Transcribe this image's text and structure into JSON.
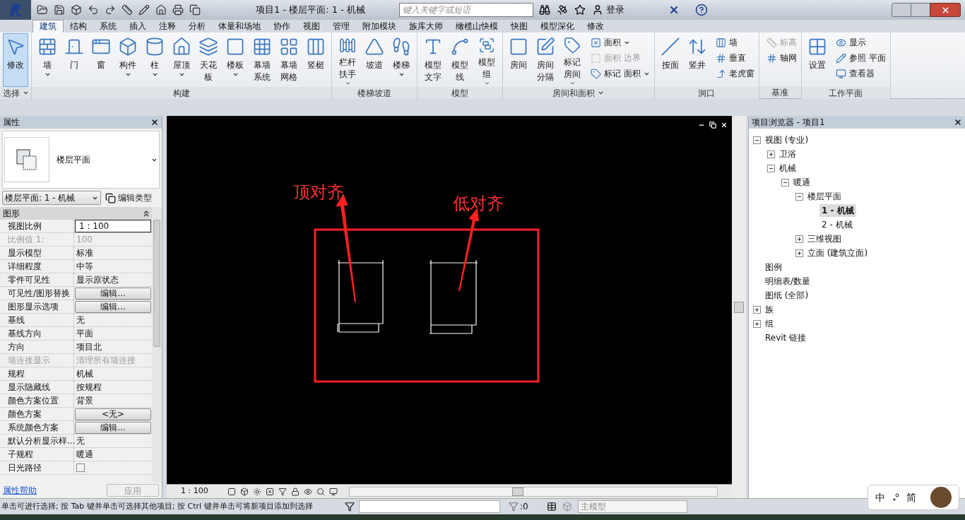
{
  "title_bar": {
    "title": "项目1 - 楼层平面: 1 - 机械",
    "search": {
      "placeholder": "键入关键字或短语"
    },
    "sign_in": "登录"
  },
  "tabs": [
    {
      "label": "建筑",
      "selected": true
    },
    {
      "label": "结构",
      "selected": false
    },
    {
      "label": "系统",
      "selected": false
    },
    {
      "label": "插入",
      "selected": false
    },
    {
      "label": "注释",
      "selected": false
    },
    {
      "label": "分析",
      "selected": false
    },
    {
      "label": "体量和场地",
      "selected": false
    },
    {
      "label": "协作",
      "selected": false
    },
    {
      "label": "视图",
      "selected": false
    },
    {
      "label": "管理",
      "selected": false
    },
    {
      "label": "附加模块",
      "selected": false
    },
    {
      "label": "族库大师",
      "selected": false
    },
    {
      "label": "橄榄山快模",
      "selected": false
    },
    {
      "label": "快图",
      "selected": false
    },
    {
      "label": "模型深化",
      "selected": false
    },
    {
      "label": "修改",
      "selected": false
    }
  ],
  "ribbon": [
    {
      "title": "选择",
      "menu": true,
      "tools": [
        {
          "label": "修改",
          "kind": "large",
          "dropdown": false,
          "disabled": false,
          "active": true
        }
      ]
    },
    {
      "title": "构建",
      "menu": false,
      "tools": [
        {
          "label": "墙",
          "kind": "large",
          "dropdown": true,
          "disabled": false,
          "active": false
        },
        {
          "label": "门",
          "kind": "large",
          "dropdown": false,
          "disabled": false,
          "active": false
        },
        {
          "label": "窗",
          "kind": "large",
          "dropdown": false,
          "disabled": false,
          "active": false
        },
        {
          "label": "构件",
          "kind": "large",
          "dropdown": true,
          "disabled": false,
          "active": false
        },
        {
          "label": "柱",
          "kind": "large",
          "dropdown": true,
          "disabled": false,
          "active": false
        },
        {
          "label": "屋顶",
          "kind": "large",
          "dropdown": true,
          "disabled": false,
          "active": false
        },
        {
          "label": "天花板",
          "kind": "large",
          "dropdown": false,
          "disabled": false,
          "active": false
        },
        {
          "label": "楼板",
          "kind": "large",
          "dropdown": true,
          "disabled": false,
          "active": false
        },
        {
          "label": "幕墙系统",
          "kind": "large",
          "dropdown": false,
          "disabled": false,
          "active": false
        },
        {
          "label": "幕墙网格",
          "kind": "large",
          "dropdown": false,
          "disabled": false,
          "active": false
        },
        {
          "label": "竖梃",
          "kind": "large",
          "dropdown": false,
          "disabled": false,
          "active": false
        }
      ]
    },
    {
      "title": "楼梯坡道",
      "menu": false,
      "tools": [
        {
          "label": "栏杆扶手",
          "kind": "large",
          "dropdown": true,
          "disabled": false,
          "active": false
        },
        {
          "label": "坡道",
          "kind": "large",
          "dropdown": false,
          "disabled": false,
          "active": false
        },
        {
          "label": "楼梯",
          "kind": "large",
          "dropdown": true,
          "disabled": false,
          "active": false
        }
      ]
    },
    {
      "title": "模型",
      "menu": false,
      "tools": [
        {
          "label": "模型文字",
          "kind": "large",
          "dropdown": false,
          "disabled": false,
          "active": false
        },
        {
          "label": "模型线",
          "kind": "large",
          "dropdown": false,
          "disabled": false,
          "active": false
        },
        {
          "label": "模型组",
          "kind": "large",
          "dropdown": true,
          "disabled": false,
          "active": false
        }
      ]
    },
    {
      "title": "房间和面积",
      "menu": true,
      "tools": [
        {
          "label": "房间",
          "kind": "large",
          "dropdown": false,
          "disabled": false,
          "active": false
        },
        {
          "label": "房间分隔",
          "kind": "large",
          "dropdown": false,
          "disabled": false,
          "active": false
        },
        {
          "label": "标记房间",
          "kind": "large",
          "dropdown": true,
          "disabled": false,
          "active": false
        },
        {
          "label": "面积",
          "kind": "small",
          "dropdown": true,
          "disabled": false,
          "active": false
        },
        {
          "label": "面积 边界",
          "kind": "small",
          "dropdown": false,
          "disabled": true,
          "active": false
        },
        {
          "label": "标记 面积",
          "kind": "small",
          "dropdown": true,
          "disabled": false,
          "active": false
        }
      ]
    },
    {
      "title": "洞口",
      "menu": false,
      "tools": [
        {
          "label": "按面",
          "kind": "large",
          "dropdown": false,
          "disabled": false,
          "active": false
        },
        {
          "label": "竖井",
          "kind": "large",
          "dropdown": false,
          "disabled": false,
          "active": false
        },
        {
          "label": "墙",
          "kind": "small",
          "dropdown": false,
          "disabled": false,
          "active": false
        },
        {
          "label": "垂直",
          "kind": "small",
          "dropdown": false,
          "disabled": false,
          "active": false
        },
        {
          "label": "老虎窗",
          "kind": "small",
          "dropdown": false,
          "disabled": false,
          "active": false
        }
      ]
    },
    {
      "title": "基准",
      "menu": false,
      "tools": [
        {
          "label": "标高",
          "kind": "small",
          "dropdown": false,
          "disabled": true,
          "active": false
        },
        {
          "label": "轴网",
          "kind": "small",
          "dropdown": false,
          "disabled": false,
          "active": false
        }
      ]
    },
    {
      "title": "工作平面",
      "menu": false,
      "tools": [
        {
          "label": "设置",
          "kind": "large",
          "dropdown": false,
          "disabled": false,
          "active": false
        },
        {
          "label": "显示",
          "kind": "small",
          "dropdown": false,
          "disabled": false,
          "active": false
        },
        {
          "label": "参照 平面",
          "kind": "small",
          "dropdown": false,
          "disabled": false,
          "active": false
        },
        {
          "label": "查看器",
          "kind": "small",
          "dropdown": false,
          "disabled": false,
          "active": false
        }
      ]
    }
  ],
  "properties": {
    "title": "属性",
    "type_name": "楼层平面",
    "instance": "楼层平面: 1 - 机械",
    "edit_type": "编辑类型",
    "section": "图形",
    "rows": [
      {
        "label": "视图比例",
        "value": "1 : 100",
        "kind": "input",
        "disabled": false
      },
      {
        "label": "比例值 1:",
        "value": "100",
        "kind": "text",
        "disabled": true
      },
      {
        "label": "显示模型",
        "value": "标准",
        "kind": "text",
        "disabled": false
      },
      {
        "label": "详细程度",
        "value": "中等",
        "kind": "text",
        "disabled": false
      },
      {
        "label": "零件可见性",
        "value": "显示原状态",
        "kind": "text",
        "disabled": false
      },
      {
        "label": "可见性/图形替换",
        "value": "编辑...",
        "kind": "button",
        "disabled": false
      },
      {
        "label": "图形显示选项",
        "value": "编辑...",
        "kind": "button",
        "disabled": false
      },
      {
        "label": "基线",
        "value": "无",
        "kind": "text",
        "disabled": false
      },
      {
        "label": "基线方向",
        "value": "平面",
        "kind": "text",
        "disabled": false
      },
      {
        "label": "方向",
        "value": "项目北",
        "kind": "text",
        "disabled": false
      },
      {
        "label": "墙连接显示",
        "value": "清理所有墙连接",
        "kind": "text",
        "disabled": true
      },
      {
        "label": "规程",
        "value": "机械",
        "kind": "text",
        "disabled": false
      },
      {
        "label": "显示隐藏线",
        "value": "按规程",
        "kind": "text",
        "disabled": false
      },
      {
        "label": "颜色方案位置",
        "value": "背景",
        "kind": "text",
        "disabled": false
      },
      {
        "label": "颜色方案",
        "value": "<无>",
        "kind": "button",
        "disabled": false
      },
      {
        "label": "系统颜色方案",
        "value": "编辑...",
        "kind": "button",
        "disabled": false
      },
      {
        "label": "默认分析显示样...",
        "value": "无",
        "kind": "text",
        "disabled": false
      },
      {
        "label": "子规程",
        "value": "暖通",
        "kind": "text",
        "disabled": false
      },
      {
        "label": "日光路径",
        "kind": "checkbox",
        "checked": false,
        "disabled": false
      }
    ],
    "help_link": "属性帮助",
    "apply": "应用"
  },
  "canvas": {
    "annotations": [
      "顶对齐",
      "低对齐"
    ],
    "scale": "1 : 100"
  },
  "browser": {
    "title": "项目浏览器 - 项目1",
    "tree": [
      {
        "label": "视图 (专业)",
        "expanded": true,
        "selected": false,
        "children": [
          {
            "label": "卫浴",
            "expanded": false,
            "selected": false
          },
          {
            "label": "机械",
            "expanded": true,
            "selected": false,
            "children": [
              {
                "label": "暖通",
                "expanded": true,
                "selected": false,
                "children": [
                  {
                    "label": "楼层平面",
                    "expanded": true,
                    "selected": false,
                    "children": [
                      {
                        "label": "1 - 机械",
                        "selected": true
                      },
                      {
                        "label": "2 - 机械",
                        "selected": false
                      }
                    ]
                  },
                  {
                    "label": "三维视图",
                    "expanded": false,
                    "selected": false
                  },
                  {
                    "label": "立面 (建筑立面)",
                    "expanded": false,
                    "selected": false
                  }
                ]
              }
            ]
          }
        ]
      },
      {
        "label": "图例",
        "selected": false
      },
      {
        "label": "明细表/数量",
        "selected": false
      },
      {
        "label": "图纸 (全部)",
        "selected": false
      },
      {
        "label": "族",
        "expanded": false,
        "selected": false
      },
      {
        "label": "组",
        "expanded": false,
        "selected": false
      },
      {
        "label": "Revit 链接",
        "selected": false
      }
    ]
  },
  "status_bar": {
    "message": "单击可进行选择; 按 Tab 键并单击可选择其他项目; 按 Ctrl 键并单击可将新项目添加到选择",
    "count": ":0",
    "model": "主模型"
  },
  "ime": [
    "中",
    "简"
  ]
}
